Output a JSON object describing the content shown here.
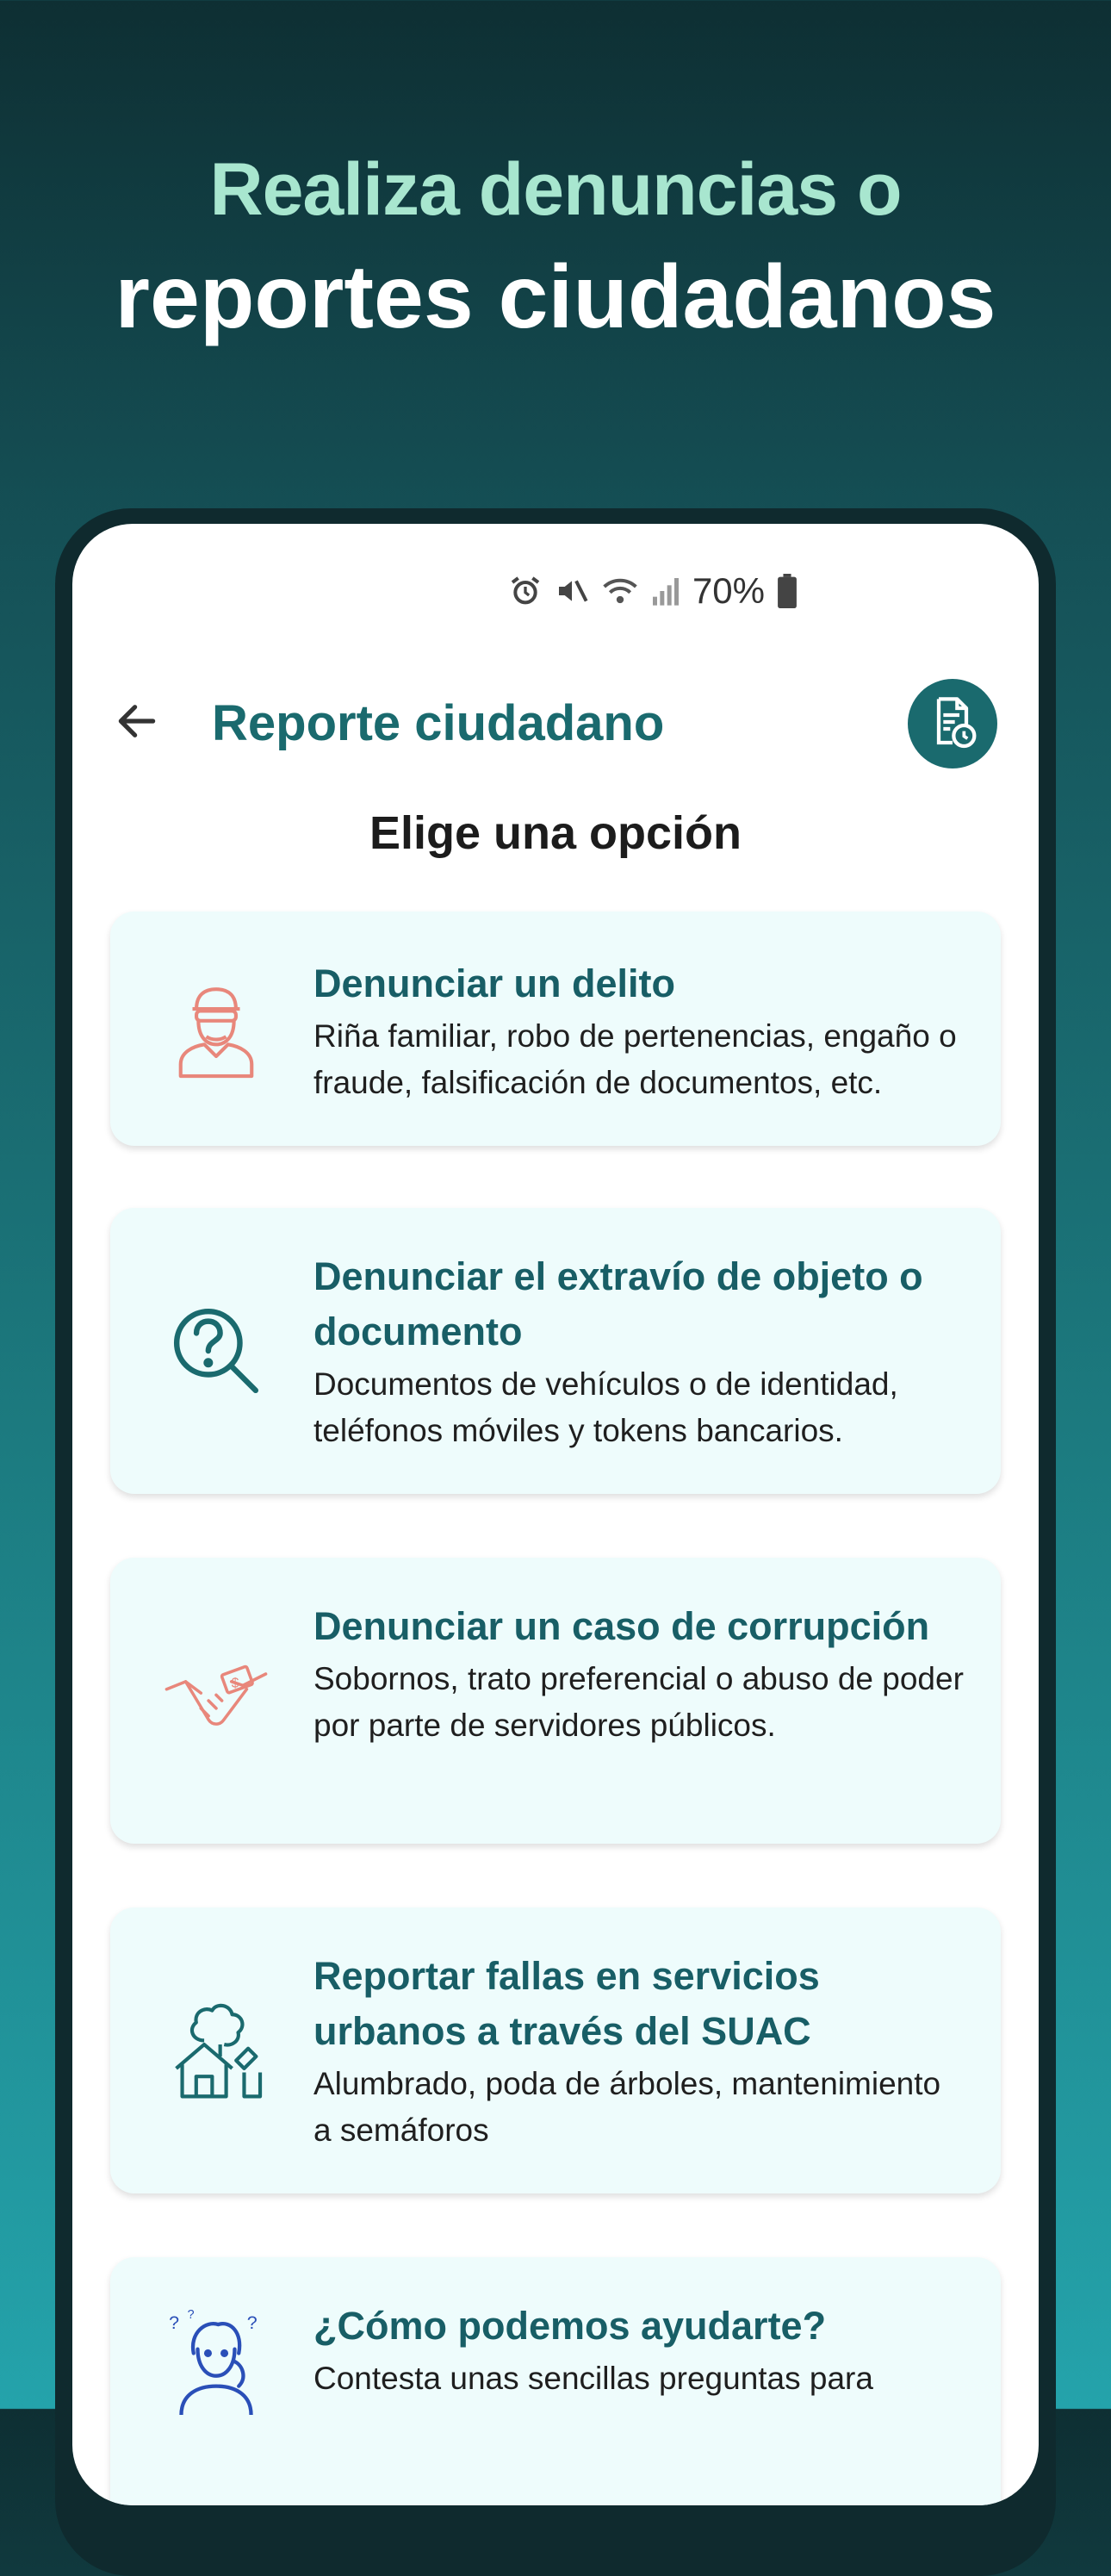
{
  "promo": {
    "line1": "Realiza denuncias o",
    "line2": "reportes ciudadanos"
  },
  "status_bar": {
    "battery": "70%",
    "icons": [
      "alarm-icon",
      "mute-icon",
      "wifi-icon",
      "signal-icon",
      "battery-icon"
    ]
  },
  "app_bar": {
    "title": "Reporte ciudadano",
    "back_icon": "arrow-left-icon",
    "history_icon": "document-history-icon"
  },
  "section_title": "Elige una opción",
  "cards": [
    {
      "title": "Denunciar un delito",
      "description": "Riña familiar, robo de pertenencias, engaño o fraude, falsificación de documentos, etc.",
      "icon": "thief-icon"
    },
    {
      "title": "Denunciar el extravío de objeto o documento",
      "description": "Documentos de vehículos o de identidad, teléfonos móviles y tokens bancarios.",
      "icon": "question-search-icon"
    },
    {
      "title": "Denunciar un caso de corrupción",
      "description": "Sobornos, trato preferencial o abuso de poder por parte de servidores públicos.",
      "icon": "bribe-handshake-icon"
    },
    {
      "title": "Reportar fallas en servicios urbanos a través del SUAC",
      "description": "Alumbrado, poda de árboles, mantenimiento a semáforos",
      "icon": "urban-services-icon"
    },
    {
      "title": "¿Cómo podemos ayudarte?",
      "description": "Contesta unas sencillas preguntas para",
      "icon": "confused-person-icon"
    }
  ],
  "colors": {
    "accent": "#1a6a6e",
    "promo_highlight": "#a8e6cf",
    "card_bg": "#eefcfc",
    "icon_coral": "#e8877b",
    "icon_teal": "#1a6a6e",
    "icon_blue": "#2a4fb8"
  }
}
